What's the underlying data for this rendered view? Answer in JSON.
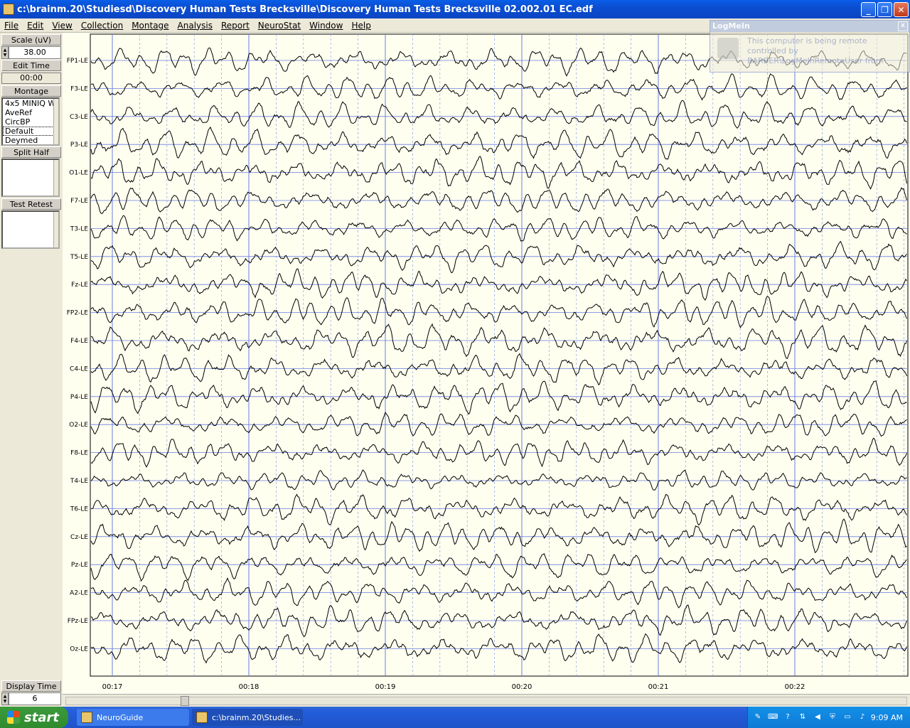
{
  "window": {
    "title": "c:\\brainm.20\\Studiesd\\Discovery Human Tests Brecksville\\Discovery Human Tests Brecksville 02.002.01  EC.edf",
    "minimize": "_",
    "maximize": "❐",
    "close": "✕"
  },
  "menu": [
    {
      "label": "File"
    },
    {
      "label": "Edit"
    },
    {
      "label": "View"
    },
    {
      "label": "Collection"
    },
    {
      "label": "Montage"
    },
    {
      "label": "Analysis"
    },
    {
      "label": "Report"
    },
    {
      "label": "NeuroStat"
    },
    {
      "label": "Window"
    },
    {
      "label": "Help"
    }
  ],
  "left_panel": {
    "scale_label": "Scale (uV)",
    "scale_value": "38.00",
    "edit_time_label": "Edit Time",
    "edit_time_value": "00:00",
    "montage_label": "Montage",
    "montage_options": [
      "4x5 MINIQ Wi",
      "AveRef",
      "CircBP",
      "Default",
      "Deymed"
    ],
    "montage_selected": "Default",
    "split_half_label": "Split Half",
    "test_retest_label": "Test Retest",
    "display_time_label": "Display Time",
    "display_time_value": "6"
  },
  "eeg": {
    "channels": [
      "FP1-LE",
      "F3-LE",
      "C3-LE",
      "P3-LE",
      "O1-LE",
      "F7-LE",
      "T3-LE",
      "T5-LE",
      "Fz-LE",
      "FP2-LE",
      "F4-LE",
      "C4-LE",
      "P4-LE",
      "O2-LE",
      "F8-LE",
      "T4-LE",
      "T6-LE",
      "Cz-LE",
      "Pz-LE",
      "A2-LE",
      "FPz-LE",
      "Oz-LE"
    ],
    "time_labels": [
      "00:17",
      "00:18",
      "00:19",
      "00:20",
      "00:21",
      "00:22"
    ],
    "trace_color": "#000000",
    "major_grid_color": "#6a7de0",
    "minor_grid_color": "#8aa0e8",
    "background_color": "#fffff0"
  },
  "logmein": {
    "title": "LogMeIn",
    "message": "This computer is being remote controlled by BARBER\\LogMeInRemoteUser from",
    "close": "x"
  },
  "taskbar": {
    "start_label": "start",
    "items": [
      {
        "label": "NeuroGuide"
      },
      {
        "label": "c:\\brainm.20\\Studies..."
      }
    ],
    "clock": "9:09 AM"
  }
}
